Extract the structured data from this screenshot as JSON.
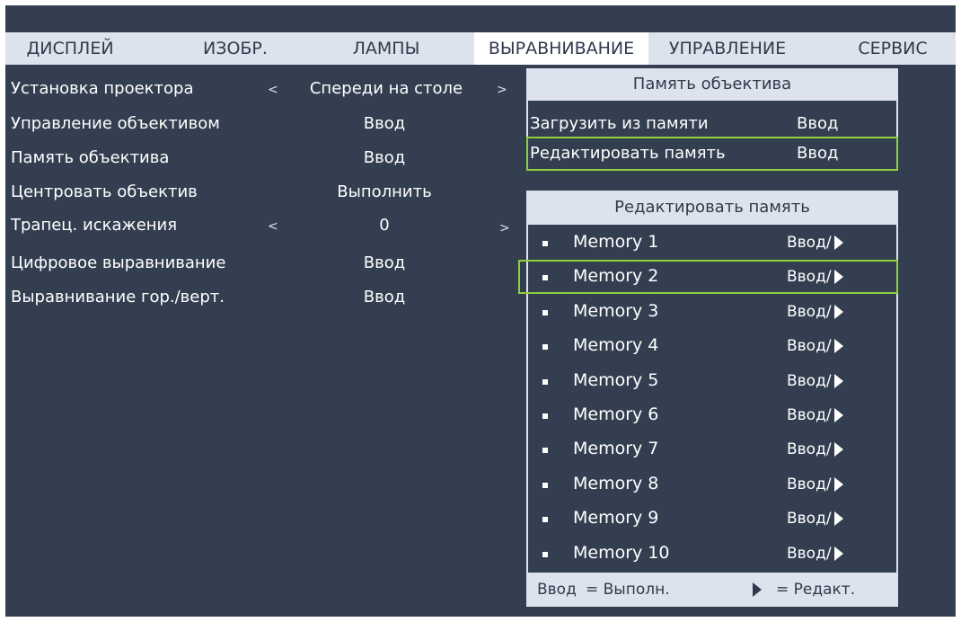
{
  "tabs": [
    "ДИСПЛЕЙ",
    "ИЗОБР.",
    "ЛАМПЫ",
    "ВЫРАВНИВАНИЕ",
    "УПРАВЛЕНИЕ",
    "СЕРВИС"
  ],
  "menu": {
    "items": [
      {
        "label": "Установка проектора",
        "value": "Спереди на столе",
        "left_arrow": "<",
        "right_arrow": ">"
      },
      {
        "label": "Управление объективом",
        "value": "Ввод"
      },
      {
        "label": "Память объектива",
        "value": "Ввод"
      },
      {
        "label": "Центровать объектив",
        "value": "Выполнить"
      },
      {
        "label": "Трапец. искажения",
        "value": "0",
        "left_arrow": "<",
        "right_arrow": ">"
      },
      {
        "label": "Цифровое выравнивание",
        "value": "Ввод"
      },
      {
        "label": "Выравнивание гор./верт.",
        "value": "Ввод"
      }
    ]
  },
  "lens_memory_panel": {
    "title": "Память объектива",
    "items": [
      {
        "label": "Загрузить из памяти",
        "value": "Ввод"
      },
      {
        "label": "Редактировать память",
        "value": "Ввод"
      }
    ]
  },
  "edit_memory_panel": {
    "title": "Редактировать память",
    "action_label": "Ввод/",
    "items": [
      "Memory 1",
      "Memory 2",
      "Memory 3",
      "Memory 4",
      "Memory 5",
      "Memory 6",
      "Memory 7",
      "Memory 8",
      "Memory 9",
      "Memory 10"
    ]
  },
  "legend": {
    "enter_label": "Ввод",
    "enter_desc": "= Выполн.",
    "edit_desc": "= Редакт."
  },
  "colors": {
    "background": "#333f50",
    "tab_bar": "#dde3ec",
    "selection": "#8fd03c"
  }
}
